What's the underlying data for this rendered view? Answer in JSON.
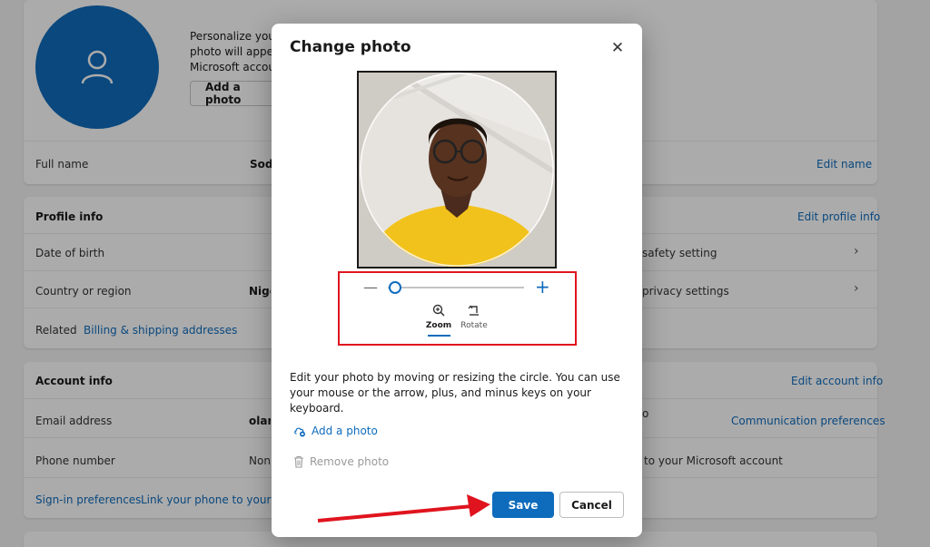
{
  "profile": {
    "personalize_lines": [
      "Personalize your",
      "photo will appea",
      "Microsoft accoun"
    ],
    "add_photo_label": "Add a photo",
    "full_name_label": "Full name",
    "full_name_value": "Sodi",
    "edit_name": "Edit name"
  },
  "profile_info": {
    "heading": "Profile info",
    "edit_link": "Edit profile info",
    "dob_label": "Date of birth",
    "country_label": "Country or region",
    "country_value": "Nige",
    "safety_setting": "safety setting",
    "privacy_settings": "privacy settings",
    "related_label": "Related",
    "billing_link": "Billing & shipping addresses"
  },
  "account_info": {
    "heading": "Account info",
    "edit_link": "Edit account info",
    "email_label": "Email address",
    "email_value": "olan",
    "email_partial": "o",
    "comm_prefs": "Communication preferences",
    "phone_label": "Phone number",
    "phone_value": "None",
    "phone_partial": "to your Microsoft account",
    "signin_prefs": "Sign-in preferences",
    "link_phone": "Link your phone to your PC"
  },
  "dialog": {
    "title": "Change photo",
    "zoom_label": "Zoom",
    "rotate_label": "Rotate",
    "zoom_level": 0.05,
    "description": "Edit your photo by moving or resizing the circle. You can use your mouse or the arrow, plus, and minus keys on your keyboard.",
    "add_photo": "Add a photo",
    "remove_photo": "Remove photo",
    "save": "Save",
    "cancel": "Cancel"
  },
  "colors": {
    "accent": "#0f6cbd",
    "highlight": "#e0141e"
  }
}
